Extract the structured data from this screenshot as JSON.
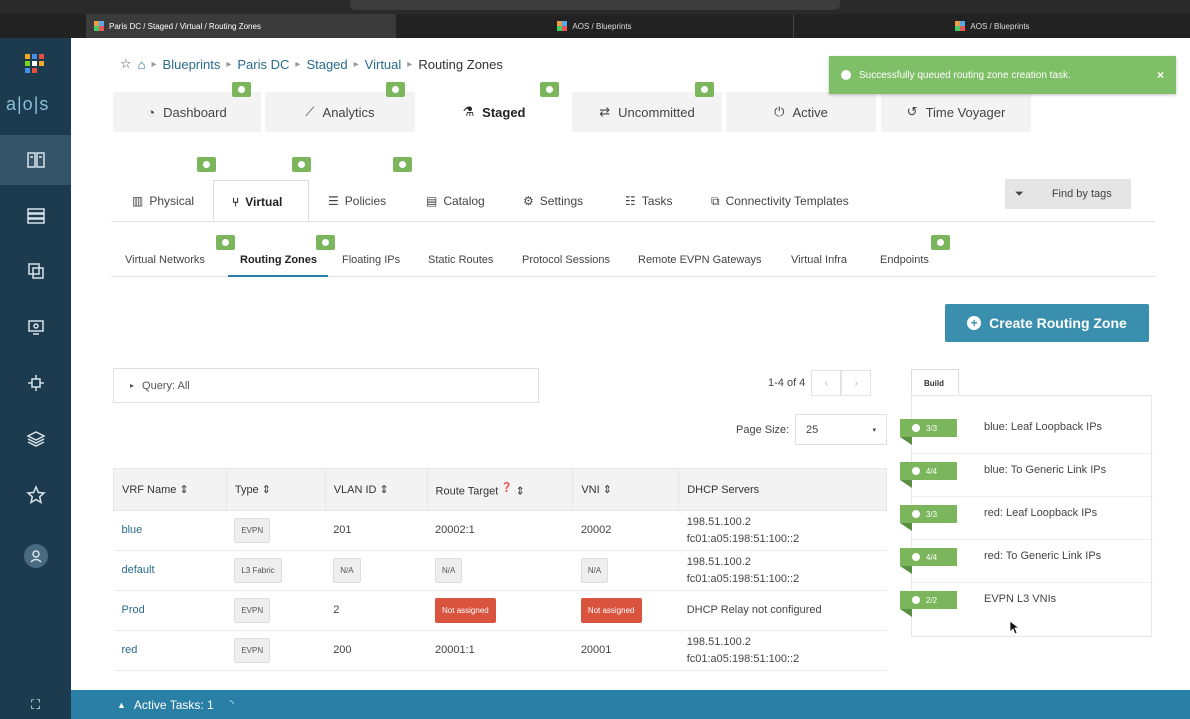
{
  "browser_tabs": [
    {
      "title": "Paris DC / Staged / Virtual / Routing Zones",
      "active": true
    },
    {
      "title": "AOS / Blueprints",
      "active": false
    },
    {
      "title": "AOS / Blueprints",
      "active": false
    }
  ],
  "app": {
    "logo_text": "a|o|s"
  },
  "breadcrumb": {
    "items": [
      "Blueprints",
      "Paris DC",
      "Staged",
      "Virtual"
    ],
    "current": "Routing Zones"
  },
  "top_tabs": [
    "Dashboard",
    "Analytics",
    "Staged",
    "Uncommitted",
    "Active",
    "Time Voyager"
  ],
  "toast": {
    "message": "Successfully queued routing zone creation task.",
    "close": "×"
  },
  "sub_tabs": [
    "Physical",
    "Virtual",
    "Policies",
    "Catalog",
    "Settings",
    "Tasks",
    "Connectivity Templates"
  ],
  "find_by_tags": "Find by tags",
  "third_tabs": [
    "Virtual Networks",
    "Routing Zones",
    "Floating IPs",
    "Static Routes",
    "Protocol Sessions",
    "Remote EVPN Gateways",
    "Virtual Infra",
    "Endpoints"
  ],
  "create_button": "Create Routing Zone",
  "query": "Query: All",
  "pagination": {
    "range": "1-4 of 4",
    "page_size_label": "Page Size:",
    "page_size": "25"
  },
  "table": {
    "headers": [
      "VRF Name ⇕",
      "Type ⇕",
      "VLAN ID ⇕",
      "Route Target",
      "VNI ⇕",
      "DHCP Servers"
    ],
    "rows": [
      {
        "name": "blue",
        "type": "EVPN",
        "vlan": "201",
        "rt": "20002:1",
        "vni": "20002",
        "dhcp1": "198.51.100.2",
        "dhcp2": "fc01:a05:198:51:100::2"
      },
      {
        "name": "default",
        "type": "L3 Fabric",
        "vlan": "N/A",
        "rt": "N/A",
        "vni": "N/A",
        "dhcp1": "198.51.100.2",
        "dhcp2": "fc01:a05:198:51:100::2"
      },
      {
        "name": "Prod",
        "type": "EVPN",
        "vlan": "2",
        "rt": "Not assigned",
        "vni": "Not assigned",
        "dhcp1": "DHCP Relay not configured",
        "dhcp2": ""
      },
      {
        "name": "red",
        "type": "EVPN",
        "vlan": "200",
        "rt": "20001:1",
        "vni": "20001",
        "dhcp1": "198.51.100.2",
        "dhcp2": "fc01:a05:198:51:100::2"
      }
    ]
  },
  "build": {
    "tab": "Build",
    "items": [
      {
        "count": "3/3",
        "label": "blue: Leaf Loopback IPs"
      },
      {
        "count": "4/4",
        "label": "blue: To Generic Link IPs"
      },
      {
        "count": "3/3",
        "label": "red: Leaf Loopback IPs"
      },
      {
        "count": "4/4",
        "label": "red: To Generic Link IPs"
      },
      {
        "count": "2/2",
        "label": "EVPN L3 VNIs"
      }
    ]
  },
  "footer": {
    "active_tasks": "Active Tasks: 1"
  },
  "colors": {
    "sidebar": "#1d3b4f",
    "accent": "#3a8fae",
    "success": "#7bb65d",
    "danger": "#d9533f",
    "footer": "#2a7fa6"
  }
}
